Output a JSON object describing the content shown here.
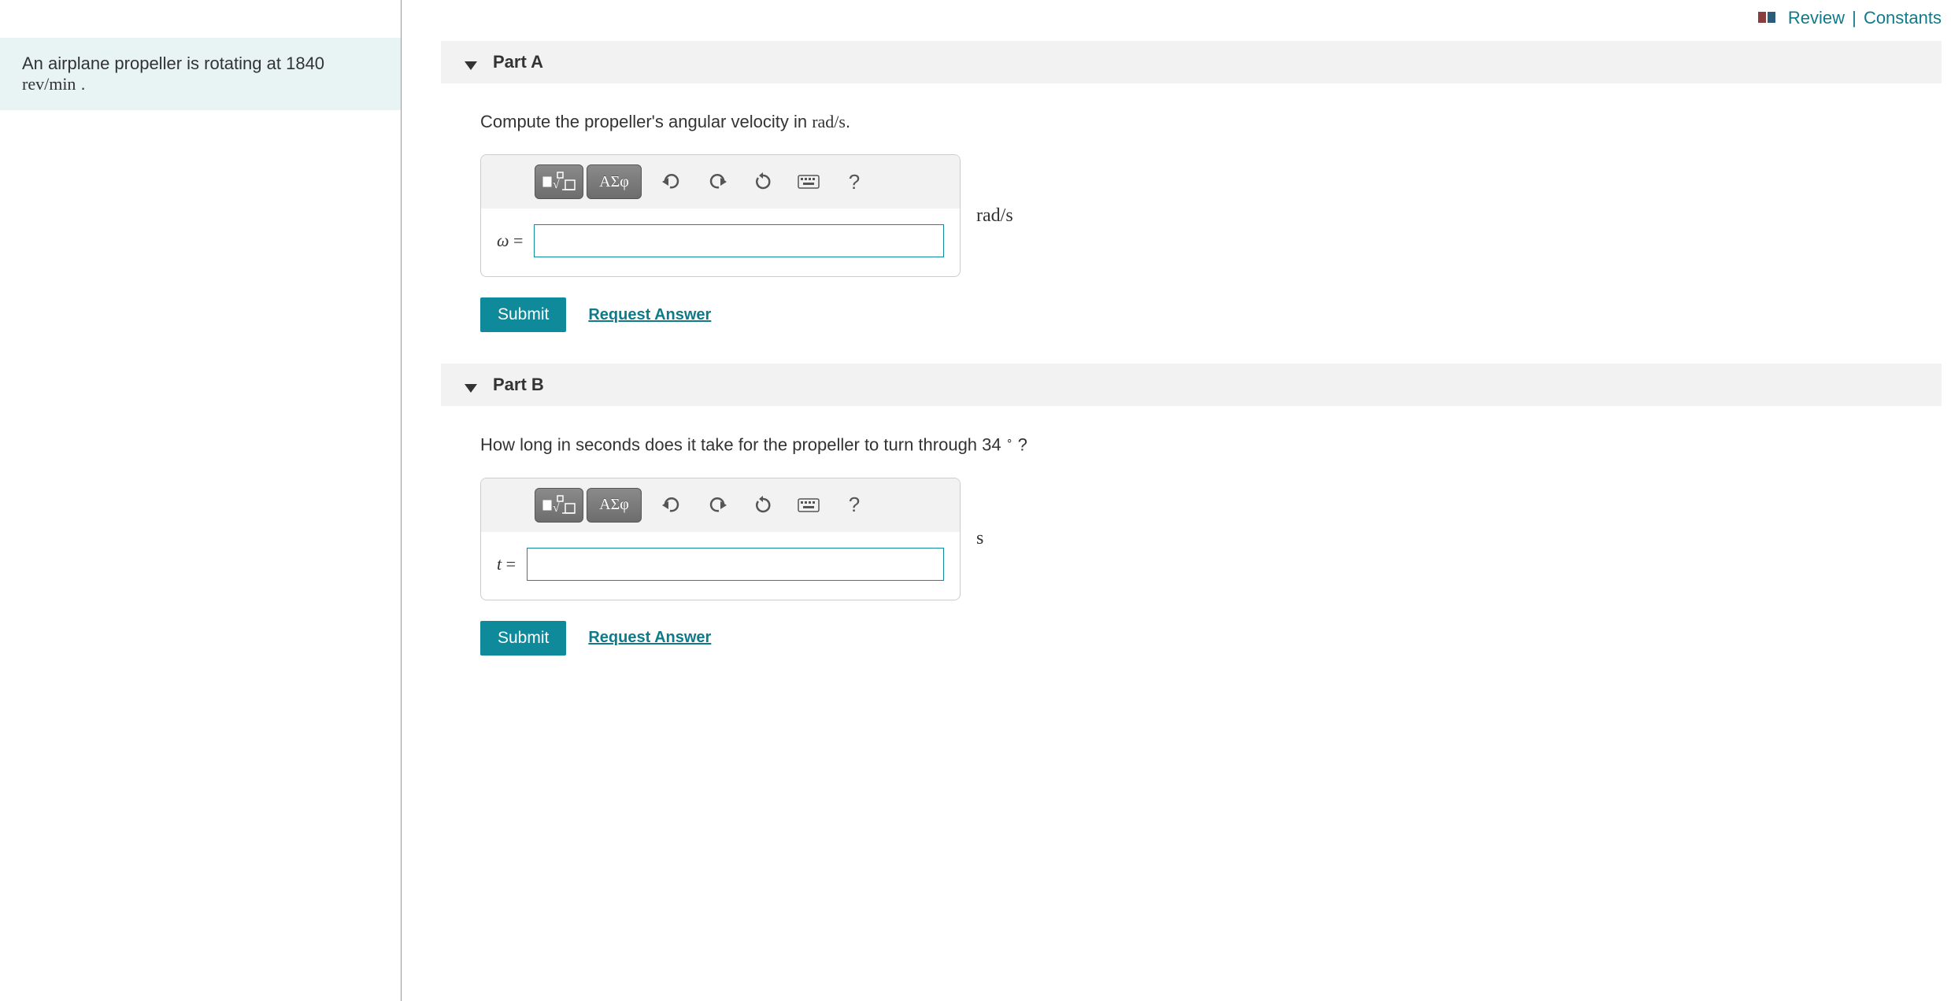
{
  "topLinks": {
    "review": "Review",
    "constants": "Constants"
  },
  "problem": {
    "text_prefix": "An airplane propeller is rotating at ",
    "value": "1840",
    "unit_html": "rev/min",
    "text_suffix": " ."
  },
  "parts": [
    {
      "header": "Part A",
      "prompt_prefix": "Compute the propeller's angular velocity in ",
      "prompt_unit": "rad/s",
      "prompt_suffix": ".",
      "variable": "ω",
      "eq": " =",
      "unit": "rad/s",
      "input_value": "",
      "toolbar": {
        "greek": "ΑΣφ",
        "help": "?"
      },
      "submit": "Submit",
      "request": "Request Answer"
    },
    {
      "header": "Part B",
      "prompt_prefix": "How long in seconds does it take for the propeller to turn through ",
      "prompt_angle": "34",
      "prompt_suffix": "?",
      "variable": "t",
      "eq": " =",
      "unit": "s",
      "input_value": "",
      "toolbar": {
        "greek": "ΑΣφ",
        "help": "?"
      },
      "submit": "Submit",
      "request": "Request Answer"
    }
  ]
}
